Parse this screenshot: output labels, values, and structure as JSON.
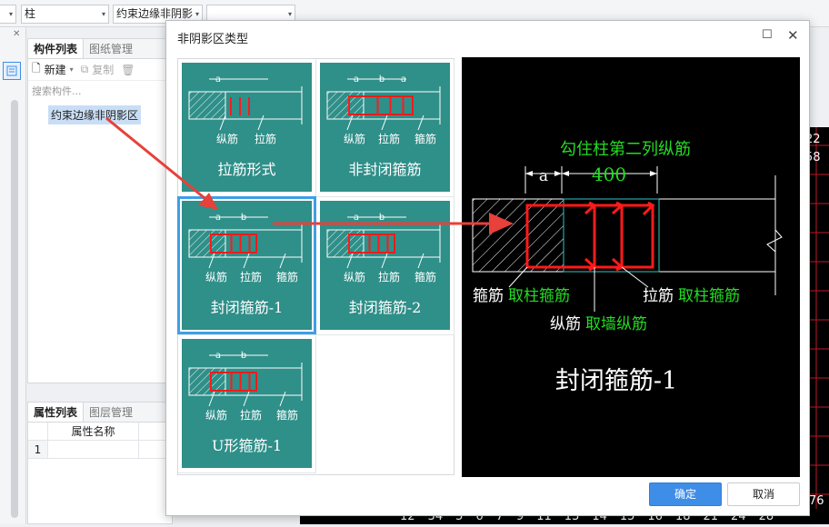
{
  "toolbar": {
    "combo_type": "柱",
    "combo_component": "约束边缘非阴影",
    "combo_blank": ""
  },
  "component_panel": {
    "tabs": [
      "构件列表",
      "图纸管理"
    ],
    "new_label": "新建",
    "copy_label": "复制",
    "search_placeholder": "搜索构件...",
    "item": "约束边缘非阴影区"
  },
  "property_panel": {
    "tabs": [
      "属性列表",
      "图层管理"
    ],
    "column_header": "属性名称",
    "row_number": "1"
  },
  "dialog": {
    "title": "非阴影区类型",
    "ok_label": "确定",
    "cancel_label": "取消",
    "types": [
      {
        "caption": "拉筋形式",
        "labels": [
          "纵筋",
          "拉筋"
        ],
        "dims": [
          "a"
        ]
      },
      {
        "caption": "非封闭箍筋",
        "labels": [
          "纵筋",
          "拉筋",
          "箍筋"
        ],
        "dims": [
          "a",
          "b",
          "a"
        ]
      },
      {
        "caption": "封闭箍筋-1",
        "labels": [
          "纵筋",
          "拉筋",
          "箍筋"
        ],
        "dims": [
          "a",
          "b"
        ]
      },
      {
        "caption": "封闭箍筋-2",
        "labels": [
          "纵筋",
          "拉筋",
          "箍筋"
        ],
        "dims": [
          "a",
          "b"
        ]
      },
      {
        "caption": "U形箍筋-1",
        "labels": [
          "纵筋",
          "拉筋",
          "箍筋"
        ],
        "dims": [
          "a",
          "b"
        ]
      }
    ],
    "selected_index": 2,
    "preview": {
      "top_note": "勾住柱第二列纵筋",
      "dim_a": "a",
      "dim_value": "400",
      "label_left_white": "箍筋",
      "label_left_green": "取柱箍筋",
      "label_right_white": "拉筋",
      "label_right_green": "取柱箍筋",
      "label_bottom_white": "纵筋",
      "label_bottom_green": "取墙纵筋",
      "caption": "封闭箍筋-1"
    }
  },
  "cad_axis_numbers": [
    "12",
    "34",
    "5",
    "6",
    "7",
    "9",
    "11",
    "13",
    "14",
    "15",
    "16",
    "18",
    "21",
    "24",
    "28"
  ],
  "cad_right_numbers": [
    "22",
    "58",
    "76"
  ],
  "colors": {
    "tile_teal": "#2f8f89",
    "selection_blue": "#3e9fe6",
    "rebar_red": "#ff1a1a",
    "annotation_green": "#22dd22",
    "arrow_red": "#e8403a",
    "ok_blue": "#3e8ee8"
  }
}
